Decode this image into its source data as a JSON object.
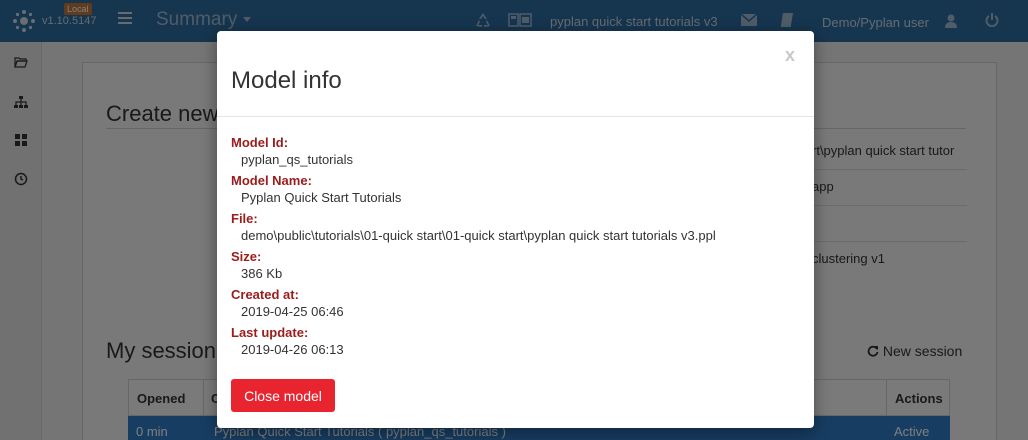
{
  "topbar": {
    "local_badge": "Local",
    "version": "v1.10.5147",
    "title": "Summary",
    "model_title": "pyplan quick start tutorials v3",
    "user": "Demo/Pyplan user"
  },
  "background": {
    "create_new_heading": "Create new",
    "list_items": [
      "rt\\pyplan quick start tutor",
      "app",
      "clustering v1"
    ],
    "my_sessions_heading": "My session",
    "new_session_label": "New session",
    "table": {
      "headers": {
        "opened": "Opened",
        "model": "C",
        "actions": "Actions"
      },
      "rows": [
        {
          "opened": "0 min",
          "model": "Pyplan Quick Start Tutorials ( pyplan_qs_tutorials )",
          "actions": "Active"
        }
      ]
    }
  },
  "modal": {
    "title": "Model info",
    "close_symbol": "x",
    "fields": [
      {
        "label": "Model Id:",
        "value": "pyplan_qs_tutorials"
      },
      {
        "label": "Model Name:",
        "value": "Pyplan Quick Start Tutorials"
      },
      {
        "label": "File:",
        "value": "demo\\public\\tutorials\\01-quick start\\01-quick start\\pyplan quick start tutorials v3.ppl"
      },
      {
        "label": "Size:",
        "value": "386 Kb"
      },
      {
        "label": "Created at:",
        "value": "2019-04-25 06:46"
      },
      {
        "label": "Last update:",
        "value": "2019-04-26 06:13"
      }
    ],
    "close_button_label": "Close model"
  },
  "colors": {
    "topbar": "#2d6a9f",
    "field_label": "#9b1c1c",
    "close_button": "#e8252e",
    "selected_row": "#2e7bc4"
  },
  "icons": {
    "logo": "pyplan-logo-icon",
    "menu": "hamburger-icon",
    "recycle": "recycle-icon",
    "model": "model-icon",
    "mail": "mail-icon",
    "book": "book-icon",
    "user": "user-icon",
    "power": "power-icon",
    "folder": "folder-open-icon",
    "hierarchy": "sitemap-icon",
    "dashboard": "grid-icon",
    "history": "clock-icon",
    "refresh": "refresh-icon"
  }
}
